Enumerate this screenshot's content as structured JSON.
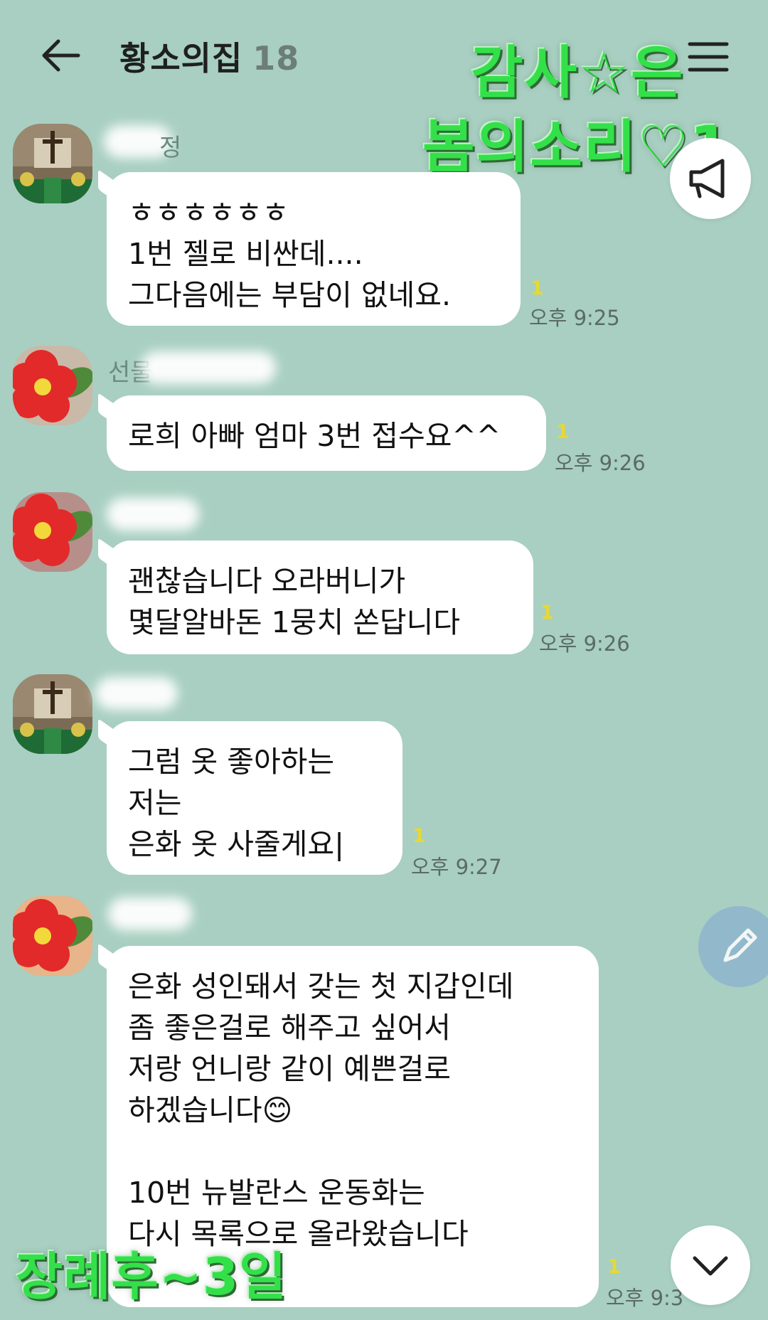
{
  "header": {
    "title": "황소의집",
    "member_count": "18"
  },
  "overlay": {
    "top_line1": "감사☆은",
    "top_line2": "봄의소리♡1",
    "bottom": "장례후~3일"
  },
  "messages": [
    {
      "sender_visible": "정",
      "text": "ㅎㅎㅎㅎㅎㅎ\n1번 젤로 비싼데....\n그다음에는 부담이 없네요.",
      "unread": "1",
      "time": "오후 9:25"
    },
    {
      "sender_visible": "선물",
      "text": "로희 아빠 엄마 3번 접수요^^",
      "unread": "1",
      "time": "오후 9:26"
    },
    {
      "sender_visible": "",
      "text": "괜찮습니다 오라버니가\n몇달알바돈 1뭉치 쏜답니다",
      "unread": "1",
      "time": "오후 9:26"
    },
    {
      "sender_visible": "",
      "text": "그럼 옷 좋아하는\n저는\n은화 옷 사줄게요|",
      "unread": "1",
      "time": "오후 9:27"
    },
    {
      "sender_visible": "",
      "text": "은화 성인돼서 갖는 첫 지갑인데\n좀 좋은걸로 해주고 싶어서\n저랑 언니랑 같이 예쁜걸로\n하겠습니다😊\n\n10번 뉴발란스 운동화는\n다시 목록으로 올라왔습니다",
      "unread": "1",
      "time": "오후 9:3"
    }
  ],
  "icons": {
    "back": "back-arrow-icon",
    "menu": "hamburger-menu-icon",
    "announcement": "megaphone-icon",
    "compose": "pen-icon",
    "scroll_down": "chevron-down-icon"
  },
  "colors": {
    "background": "#a8cfc1",
    "bubble": "#ffffff",
    "unread": "#e8d832",
    "overlay_text": "#34e04a"
  }
}
